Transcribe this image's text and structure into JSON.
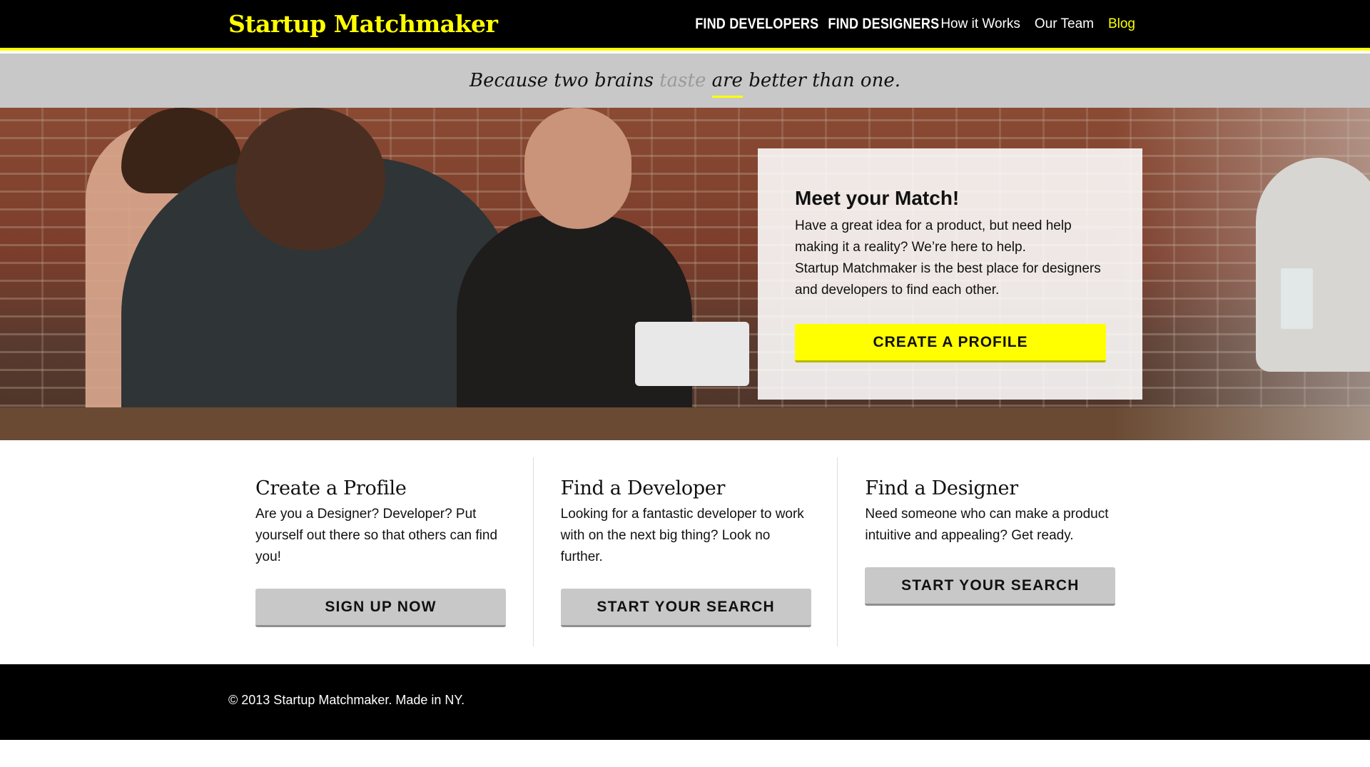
{
  "header": {
    "brand": "Startup Matchmaker",
    "nav": [
      {
        "label": "FIND DEVELOPERS"
      },
      {
        "label": "FIND DESIGNERS"
      },
      {
        "label": "How it Works"
      },
      {
        "label": "Our Team"
      },
      {
        "label": "Blog"
      }
    ],
    "accent_color": "#ffff00"
  },
  "tagline": {
    "before": "Because two brains",
    "struck": "taste",
    "underlined": "are",
    "after": "better than one."
  },
  "hero": {
    "card_title": "Meet your Match!",
    "card_paragraph_1": "Have a great idea for a product, but need help making it a reality? We’re here to help.",
    "card_paragraph_2": "Startup Matchmaker is the best place for designers and developers to find each other.",
    "cta_label": "CREATE A PROFILE"
  },
  "features": [
    {
      "title": "Create a Profile",
      "text": "Are you a Designer? Developer? Put yourself out there so that others can find you!",
      "button": "SIGN UP NOW"
    },
    {
      "title": "Find a Developer",
      "text": "Looking for a fantastic developer to work with on the next big thing? Look no further.",
      "button": "START YOUR SEARCH"
    },
    {
      "title": "Find a Designer",
      "text": "Need someone who can make a product intuitive and appealing? Get ready.",
      "button": "START YOUR SEARCH"
    }
  ],
  "footer": {
    "text": "© 2013 Startup Matchmaker. Made in NY."
  }
}
